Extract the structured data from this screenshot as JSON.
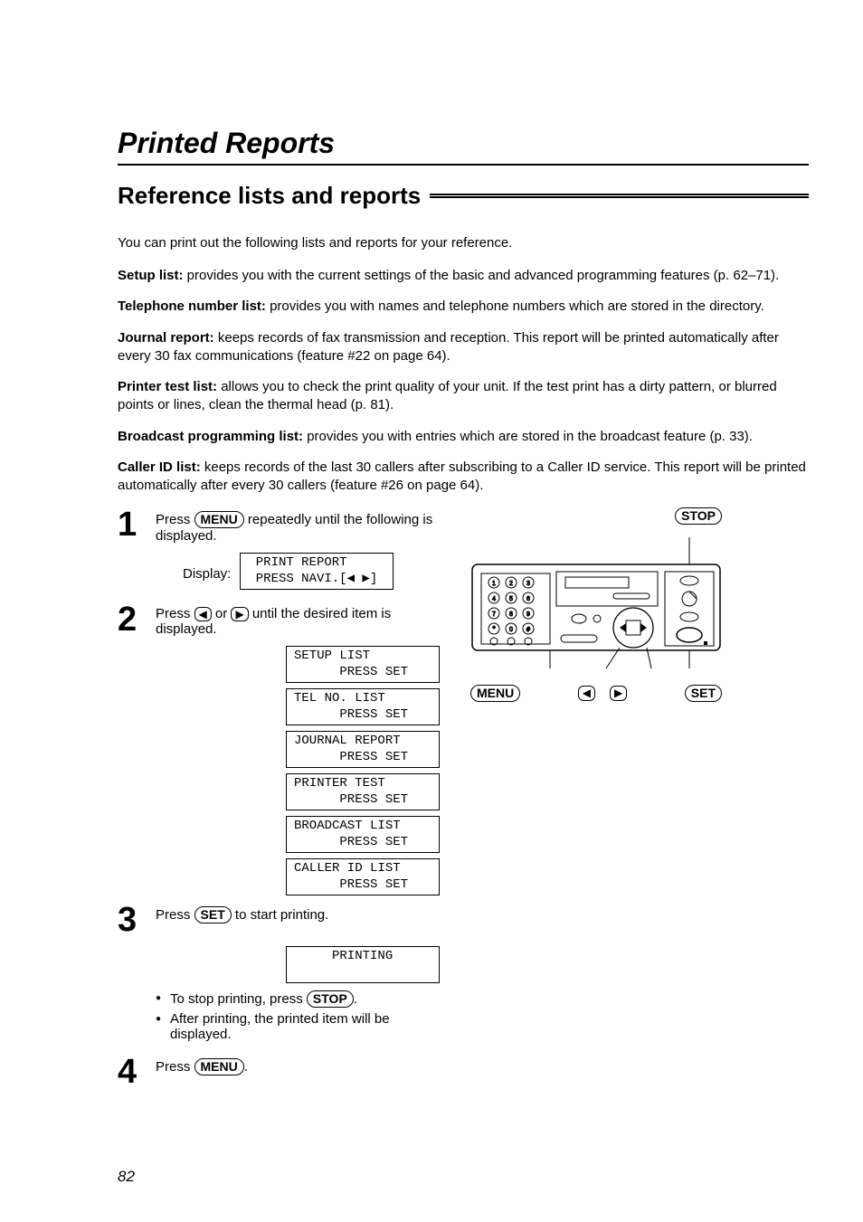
{
  "page_title": "Printed Reports",
  "section_heading": "Reference lists and reports",
  "intro": "You can print out the following lists and reports for your reference.",
  "descriptions": [
    {
      "label": "Setup list:",
      "text": " provides you with the current settings of the basic and advanced programming features (p. 62–71)."
    },
    {
      "label": "Telephone number list:",
      "text": " provides you with names and telephone numbers which are stored in the directory."
    },
    {
      "label": "Journal report:",
      "text": " keeps records of fax transmission and reception. This report will be printed automatically after every 30 fax communications (feature #22 on page 64)."
    },
    {
      "label": "Printer test list:",
      "text": " allows you to check the print quality of your unit. If the test print has a dirty pattern, or blurred points or lines, clean the thermal head (p. 81)."
    },
    {
      "label": "Broadcast programming list:",
      "text": " provides you with entries which are stored in the broadcast feature (p. 33)."
    },
    {
      "label": "Caller ID list:",
      "text": " keeps records of the last 30 callers after subscribing to a Caller ID service. This report will be printed automatically after every 30 callers (feature #26 on page 64)."
    }
  ],
  "buttons": {
    "menu": "MENU",
    "set": "SET",
    "stop": "STOP",
    "left": "◀",
    "right": "▶"
  },
  "step1": {
    "num": "1",
    "text_before": "Press ",
    "text_after": " repeatedly until the following is displayed.",
    "display_label": "Display:",
    "lcd": " PRINT REPORT\n PRESS NAVI.[◀ ▶]"
  },
  "step2": {
    "num": "2",
    "text_before": "Press ",
    "text_mid": " or ",
    "text_after": " until the desired item is displayed.",
    "lcds": [
      "SETUP LIST\n      PRESS SET",
      "TEL NO. LIST\n      PRESS SET",
      "JOURNAL REPORT\n      PRESS SET",
      "PRINTER TEST\n      PRESS SET",
      "BROADCAST LIST\n      PRESS SET",
      "CALLER ID LIST\n      PRESS SET"
    ]
  },
  "step3": {
    "num": "3",
    "text_before": "Press ",
    "text_after": " to start printing.",
    "lcd": "     PRINTING\n ",
    "bullets_before": "To stop printing, press ",
    "bullets_after": ".",
    "bullet2": "After printing, the printed item will be displayed."
  },
  "step4": {
    "num": "4",
    "text_before": "Press ",
    "text_after": "."
  },
  "page_number": "82"
}
